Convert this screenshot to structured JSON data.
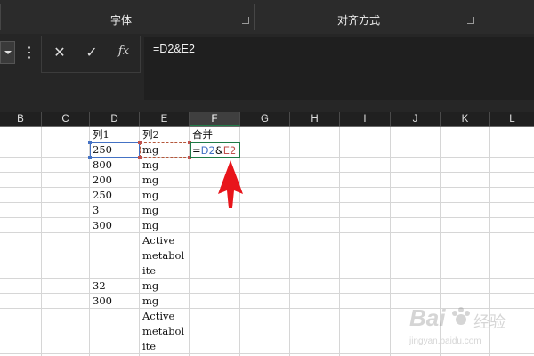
{
  "ribbon": {
    "groups": [
      {
        "label": "字体"
      },
      {
        "label": "对齐方式"
      }
    ]
  },
  "formula_bar": {
    "cancel_symbol": "✕",
    "enter_symbol": "✓",
    "fx_symbol": "fx",
    "more_symbol": "⋮",
    "formula": "=D2&E2"
  },
  "columns": [
    "B",
    "C",
    "D",
    "E",
    "F",
    "G",
    "H",
    "I",
    "J",
    "K",
    "L"
  ],
  "active_column": "F",
  "cells": {
    "D": [
      "列1",
      "250",
      "800",
      "200",
      "250",
      "3",
      "300",
      "",
      "",
      "",
      "32",
      "300",
      "",
      "",
      ""
    ],
    "E": [
      "列2",
      "mg",
      "mg",
      "mg",
      "mg",
      "mg",
      "mg",
      "Active",
      "metabol",
      "ite",
      "mg",
      "mg",
      "Active",
      "metabol",
      "ite"
    ],
    "F": [
      "合并",
      "",
      "",
      "",
      "",
      "",
      "",
      "",
      "",
      "",
      "",
      "",
      "",
      "",
      ""
    ]
  },
  "editing_cell": {
    "ref_d": "D2",
    "amp": "&",
    "ref_e": "E2",
    "prefix": "=",
    "colors": {
      "d": "#4472c4",
      "e": "#c0504d",
      "amp": "#111111"
    }
  },
  "watermark": {
    "brand": "Bai",
    "brand2": "经验",
    "url": "jingyan.baidu.com"
  },
  "colors": {
    "accent_green": "#1f7a46",
    "arrow_red": "#e8151b"
  }
}
